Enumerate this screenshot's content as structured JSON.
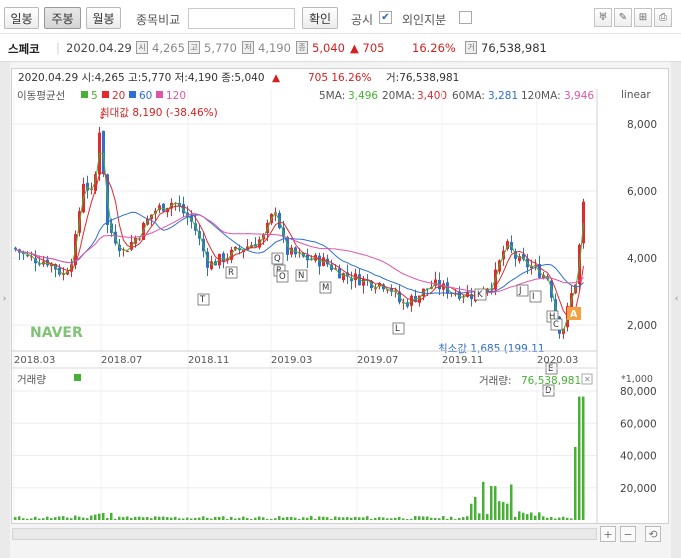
{
  "toolbar": {
    "daily": "일봉",
    "weekly": "주봉",
    "monthly": "월봉",
    "compare_label": "종목비교",
    "search_value": "",
    "confirm": "확인",
    "notice": "공시",
    "foreign": "외인지분"
  },
  "info": {
    "name": "스페코",
    "date": "2020.04.29",
    "open": "4,265",
    "high": "5,770",
    "low": "4,190",
    "close": "5,040",
    "change": "▲ 705",
    "pct": "16.26%",
    "volume": "76,538,981"
  },
  "chart_header": {
    "line1_prefix": "2020.04.29 시:4,265 고:5,770 저:4,190 종:5,040",
    "line1_arrow": "▲",
    "line1_change": "705  16.26%",
    "line1_vol": "거:76,538,981",
    "ma_label": "이동평균선",
    "ma5": "5",
    "ma20": "20",
    "ma60": "60",
    "ma120": "120",
    "scale": "linear",
    "ma_values": {
      "ma5_label": "5MA:",
      "ma5": "3,496",
      "ma20_label": "20MA:",
      "ma20": "3,400",
      "ma60_label": "60MA:",
      "ma60": "3,281",
      "ma120_label": "120MA:",
      "ma120": "3,946"
    },
    "max_label": "최대값 8,190 (-38.46%)",
    "min_label": "최소값 1,685 (199.11",
    "logo": "NAVER",
    "vol_title": "거래량",
    "vol_readout_label": "거래량:",
    "vol_readout_value": "76,538,981",
    "unit": "*1,000"
  },
  "colors": {
    "up": "#e3292d",
    "down": "#2e6fd0",
    "ma5": "#46b133",
    "ma20": "#e3292d",
    "ma60": "#2e6fd0",
    "ma120": "#e055a8"
  },
  "chart_data": {
    "type": "candlestick",
    "price_axis_ticks": [
      "8,000",
      "6,000",
      "4,000",
      "2,000"
    ],
    "volume_axis_ticks": [
      "80,000",
      "60,000",
      "40,000",
      "20,000"
    ],
    "x_ticks": [
      "2018.03",
      "2018.07",
      "2018.11",
      "2019.03",
      "2019.07",
      "2019.11",
      "2020.03"
    ],
    "markers": [
      "T",
      "R",
      "Q",
      "P",
      "O",
      "N",
      "M",
      "L",
      "K",
      "J",
      "I",
      "H",
      "C",
      "E",
      "D",
      "A"
    ],
    "last_close": 5040,
    "max": 8190,
    "min": 1685
  }
}
